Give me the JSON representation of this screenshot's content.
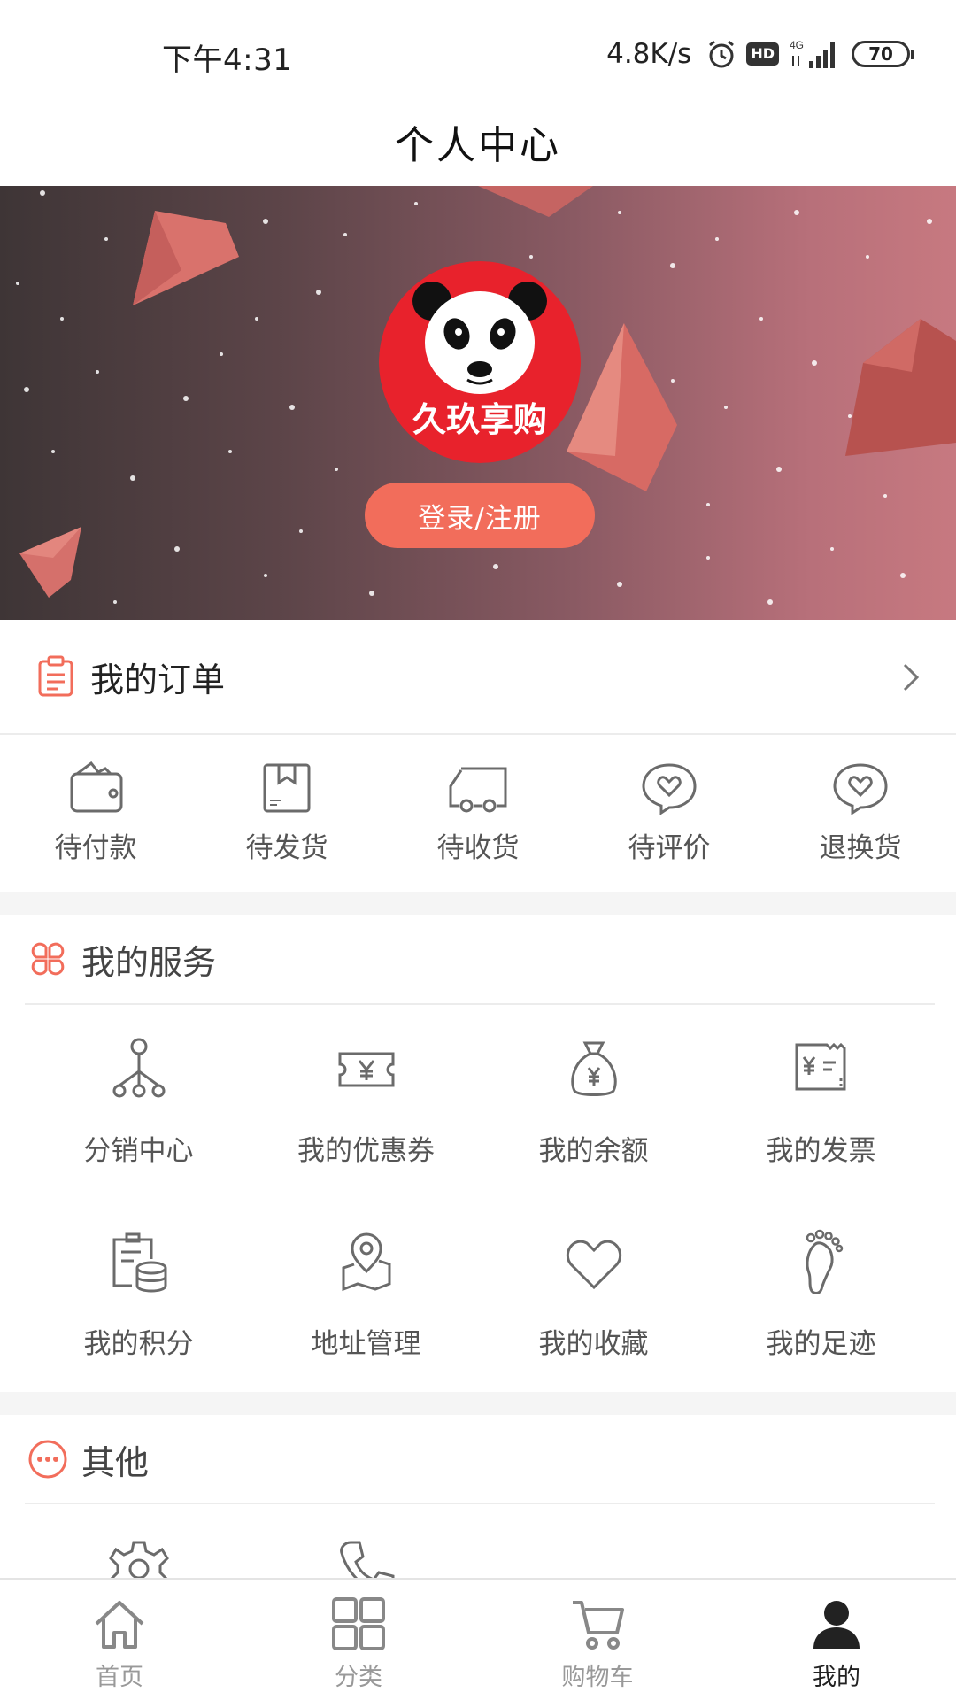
{
  "status_bar": {
    "time": "下午4:31",
    "net_speed": "4.8K/s",
    "hd": "HD",
    "network": "4G",
    "battery": "70"
  },
  "header": {
    "title": "个人中心"
  },
  "banner": {
    "avatar_text": "久玖享购",
    "login_label": "登录/注册"
  },
  "orders": {
    "title": "我的订单",
    "statuses": [
      {
        "label": "待付款",
        "icon": "wallet-icon"
      },
      {
        "label": "待发货",
        "icon": "box-icon"
      },
      {
        "label": "待收货",
        "icon": "truck-icon"
      },
      {
        "label": "待评价",
        "icon": "heart-bubble-icon"
      },
      {
        "label": "退换货",
        "icon": "heart-bubble-icon"
      }
    ]
  },
  "services": {
    "title": "我的服务",
    "items": [
      {
        "label": "分销中心",
        "icon": "network-icon"
      },
      {
        "label": "我的优惠券",
        "icon": "coupon-icon"
      },
      {
        "label": "我的余额",
        "icon": "money-bag-icon"
      },
      {
        "label": "我的发票",
        "icon": "invoice-icon"
      },
      {
        "label": "我的积分",
        "icon": "points-icon"
      },
      {
        "label": "地址管理",
        "icon": "map-pin-icon"
      },
      {
        "label": "我的收藏",
        "icon": "heart-icon"
      },
      {
        "label": "我的足迹",
        "icon": "footprint-icon"
      }
    ]
  },
  "others": {
    "title": "其他",
    "items": [
      {
        "icon": "settings-icon"
      },
      {
        "icon": "phone-icon"
      }
    ]
  },
  "bottom_nav": {
    "items": [
      {
        "label": "首页",
        "icon": "home-icon"
      },
      {
        "label": "分类",
        "icon": "grid-icon"
      },
      {
        "label": "购物车",
        "icon": "cart-icon"
      },
      {
        "label": "我的",
        "icon": "user-icon"
      }
    ],
    "active_index": 3
  },
  "colors": {
    "accent": "#f26d5b",
    "icon_gray": "#6b6b6b",
    "nav_inactive": "#999999",
    "nav_active": "#222222"
  }
}
